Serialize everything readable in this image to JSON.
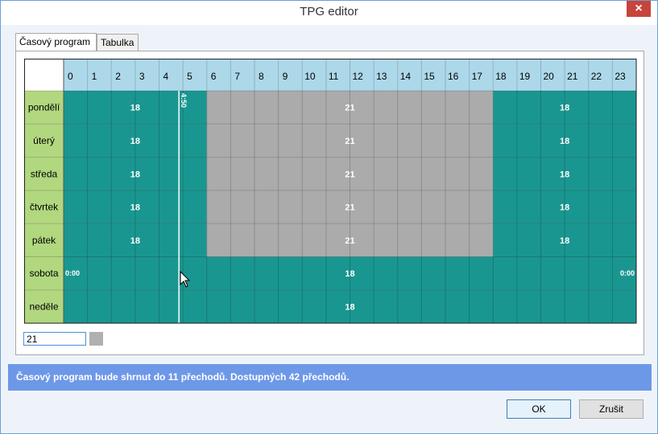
{
  "window": {
    "title": "TPG editor"
  },
  "tabs": [
    {
      "label": "Časový program",
      "active": true
    },
    {
      "label": "Tabulka",
      "active": false
    }
  ],
  "grid": {
    "hours": [
      "0",
      "1",
      "2",
      "3",
      "4",
      "5",
      "6",
      "7",
      "8",
      "9",
      "10",
      "11",
      "12",
      "13",
      "14",
      "15",
      "16",
      "17",
      "18",
      "19",
      "20",
      "21",
      "22",
      "23"
    ],
    "colors": {
      "teal": "#1a9690",
      "grey": "#ababab",
      "header": "#acd8ea",
      "label": "#b1d77f"
    },
    "marker_time": "4:50",
    "days": [
      {
        "name": "pondělí",
        "segments": [
          {
            "from": 0,
            "to": 6,
            "color": "teal",
            "label": "18"
          },
          {
            "from": 6,
            "to": 18,
            "color": "grey",
            "label": "21"
          },
          {
            "from": 18,
            "to": 24,
            "color": "teal",
            "label": "18"
          }
        ]
      },
      {
        "name": "úterý",
        "segments": [
          {
            "from": 0,
            "to": 6,
            "color": "teal",
            "label": "18"
          },
          {
            "from": 6,
            "to": 18,
            "color": "grey",
            "label": "21"
          },
          {
            "from": 18,
            "to": 24,
            "color": "teal",
            "label": "18"
          }
        ]
      },
      {
        "name": "středa",
        "segments": [
          {
            "from": 0,
            "to": 6,
            "color": "teal",
            "label": "18"
          },
          {
            "from": 6,
            "to": 18,
            "color": "grey",
            "label": "21"
          },
          {
            "from": 18,
            "to": 24,
            "color": "teal",
            "label": "18"
          }
        ]
      },
      {
        "name": "čtvrtek",
        "segments": [
          {
            "from": 0,
            "to": 6,
            "color": "teal",
            "label": "18"
          },
          {
            "from": 6,
            "to": 18,
            "color": "grey",
            "label": "21"
          },
          {
            "from": 18,
            "to": 24,
            "color": "teal",
            "label": "18"
          }
        ]
      },
      {
        "name": "pátek",
        "segments": [
          {
            "from": 0,
            "to": 6,
            "color": "teal",
            "label": "18"
          },
          {
            "from": 6,
            "to": 18,
            "color": "grey",
            "label": "21"
          },
          {
            "from": 18,
            "to": 24,
            "color": "teal",
            "label": "18"
          }
        ]
      },
      {
        "name": "sobota",
        "segments": [
          {
            "from": 0,
            "to": 24,
            "color": "teal",
            "label": "18"
          }
        ],
        "start_label": "0:00",
        "end_label": "0:00"
      },
      {
        "name": "neděle",
        "segments": [
          {
            "from": 0,
            "to": 24,
            "color": "teal",
            "label": "18"
          }
        ]
      }
    ]
  },
  "editor": {
    "value": "21",
    "swatch_color": "#b0b0b0"
  },
  "info": {
    "text": "Časový program bude shrnut do 11 přechodů. Dostupných 42 přechodů."
  },
  "buttons": {
    "ok": "OK",
    "cancel": "Zrušit"
  }
}
